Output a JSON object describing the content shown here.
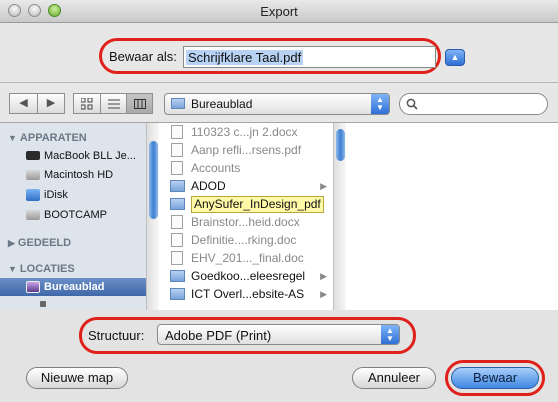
{
  "window": {
    "title": "Export"
  },
  "save": {
    "label": "Bewaar als:",
    "filename": "Schrijfklare Taal.pdf"
  },
  "toolbar": {
    "back": "◀",
    "forward": "▶",
    "views": [
      "icon",
      "list",
      "column"
    ],
    "location": "Bureaublad",
    "search_placeholder": ""
  },
  "sidebar": {
    "sections": [
      {
        "title": "APPARATEN",
        "items": [
          "MacBook BLL Je...",
          "Macintosh HD",
          "iDisk",
          "BOOTCAMP"
        ]
      },
      {
        "title": "GEDEELD",
        "items": []
      },
      {
        "title": "LOCATIES",
        "items": [
          "Bureaublad"
        ]
      }
    ],
    "selected": "Bureaublad"
  },
  "files": [
    {
      "name": "110323 c...jn 2.docx",
      "kind": "doc"
    },
    {
      "name": "Aanp refli...rsens.pdf",
      "kind": "doc"
    },
    {
      "name": "Accounts",
      "kind": "doc"
    },
    {
      "name": "ADOD",
      "kind": "folder"
    },
    {
      "name": "AnySufer_InDesign_pdf",
      "kind": "folder"
    },
    {
      "name": "Brainstor...heid.docx",
      "kind": "doc"
    },
    {
      "name": "Definitie....rking.doc",
      "kind": "doc"
    },
    {
      "name": "EHV_201..._final.doc",
      "kind": "doc"
    },
    {
      "name": "Goedkoo...eleesregel",
      "kind": "folder"
    },
    {
      "name": "ICT Overl...ebsite-AS",
      "kind": "folder"
    }
  ],
  "format": {
    "label": "Structuur:",
    "value": "Adobe PDF (Print)"
  },
  "buttons": {
    "new_folder": "Nieuwe map",
    "cancel": "Annuleer",
    "save": "Bewaar"
  },
  "colors": {
    "highlight": "#e0201a",
    "accent": "#3f88e5"
  }
}
